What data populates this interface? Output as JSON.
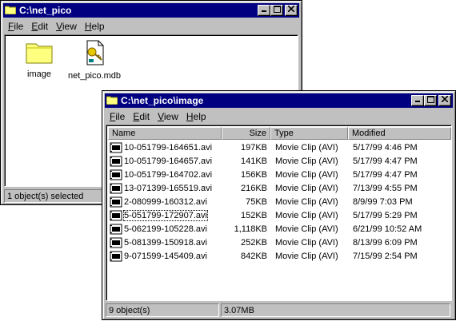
{
  "window1": {
    "title": "C:\\net_pico",
    "menu": [
      {
        "label": "File"
      },
      {
        "label": "Edit"
      },
      {
        "label": "View"
      },
      {
        "label": "Help"
      }
    ],
    "icons": [
      {
        "label": "image",
        "icon": "folder-icon"
      },
      {
        "label": "net_pico.mdb",
        "icon": "database-file-icon"
      }
    ],
    "status": "1 object(s) selected"
  },
  "window2": {
    "title": "C:\\net_pico\\image",
    "menu": [
      {
        "label": "File"
      },
      {
        "label": "Edit"
      },
      {
        "label": "View"
      },
      {
        "label": "Help"
      }
    ],
    "columns": {
      "name": "Name",
      "size": "Size",
      "type": "Type",
      "modified": "Modified"
    },
    "files": [
      {
        "name": "10-051799-164651.avi",
        "size": "197KB",
        "type": "Movie Clip (AVI)",
        "modified": "5/17/99 4:46 PM"
      },
      {
        "name": "10-051799-164657.avi",
        "size": "141KB",
        "type": "Movie Clip (AVI)",
        "modified": "5/17/99 4:47 PM"
      },
      {
        "name": "10-051799-164702.avi",
        "size": "156KB",
        "type": "Movie Clip (AVI)",
        "modified": "5/17/99 4:47 PM"
      },
      {
        "name": "13-071399-165519.avi",
        "size": "216KB",
        "type": "Movie Clip (AVI)",
        "modified": "7/13/99 4:55 PM"
      },
      {
        "name": "2-080999-160312.avi",
        "size": "75KB",
        "type": "Movie Clip (AVI)",
        "modified": "8/9/99 7:03 PM"
      },
      {
        "name": "5-051799-172907.avi",
        "size": "152KB",
        "type": "Movie Clip (AVI)",
        "modified": "5/17/99 5:29 PM"
      },
      {
        "name": "5-062199-105228.avi",
        "size": "1,118KB",
        "type": "Movie Clip (AVI)",
        "modified": "6/21/99 10:52 AM"
      },
      {
        "name": "5-081399-150918.avi",
        "size": "252KB",
        "type": "Movie Clip (AVI)",
        "modified": "8/13/99 6:09 PM"
      },
      {
        "name": "9-071599-145409.avi",
        "size": "842KB",
        "type": "Movie Clip (AVI)",
        "modified": "7/15/99 2:54 PM"
      }
    ],
    "status_count": "9 object(s)",
    "status_size": "3.07MB"
  },
  "colors": {
    "titlebar": "#000080",
    "chrome": "#c0c0c0"
  }
}
